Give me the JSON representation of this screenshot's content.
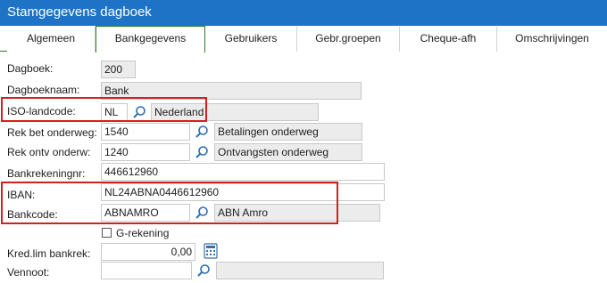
{
  "window": {
    "title": "Stamgegevens dagboek"
  },
  "tabs": [
    {
      "label": "Algemeen"
    },
    {
      "label": "Bankgegevens",
      "active": true
    },
    {
      "label": "Gebruikers"
    },
    {
      "label": "Gebr.groepen"
    },
    {
      "label": "Cheque-afh"
    },
    {
      "label": "Omschrijvingen"
    }
  ],
  "form": {
    "dagboek": {
      "label": "Dagboek:",
      "value": "200"
    },
    "dagboeknaam": {
      "label": "Dagboeknaam:",
      "value": "Bank"
    },
    "iso": {
      "label": "ISO-landcode:",
      "code": "NL",
      "name": "Nederland"
    },
    "rek_bet": {
      "label": "Rek bet onderweg:",
      "value": "1540",
      "desc": "Betalingen onderweg"
    },
    "rek_ontv": {
      "label": "Rek ontv onderw:",
      "value": "1240",
      "desc": "Ontvangsten onderweg"
    },
    "bankrekeningnr": {
      "label": "Bankrekeningnr:",
      "value": "446612960"
    },
    "iban": {
      "label": "IBAN:",
      "value": "NL24ABNA0446612960"
    },
    "bankcode": {
      "label": "Bankcode:",
      "value": "ABNAMRO",
      "desc": "ABN Amro"
    },
    "g_rekening": {
      "label": "G-rekening",
      "checked": false
    },
    "kred_lim": {
      "label": "Kred.lim bankrek:",
      "value": "0,00"
    },
    "vennoot": {
      "label": "Vennoot:",
      "value": "",
      "desc": ""
    }
  },
  "icons": {
    "lookup": "magnifier-icon",
    "calculator": "calculator-icon"
  },
  "colors": {
    "titlebar": "#1f73c7",
    "active_tab_border": "#2e7d32",
    "highlight": "#d32020",
    "readonly_bg": "#ececec"
  }
}
